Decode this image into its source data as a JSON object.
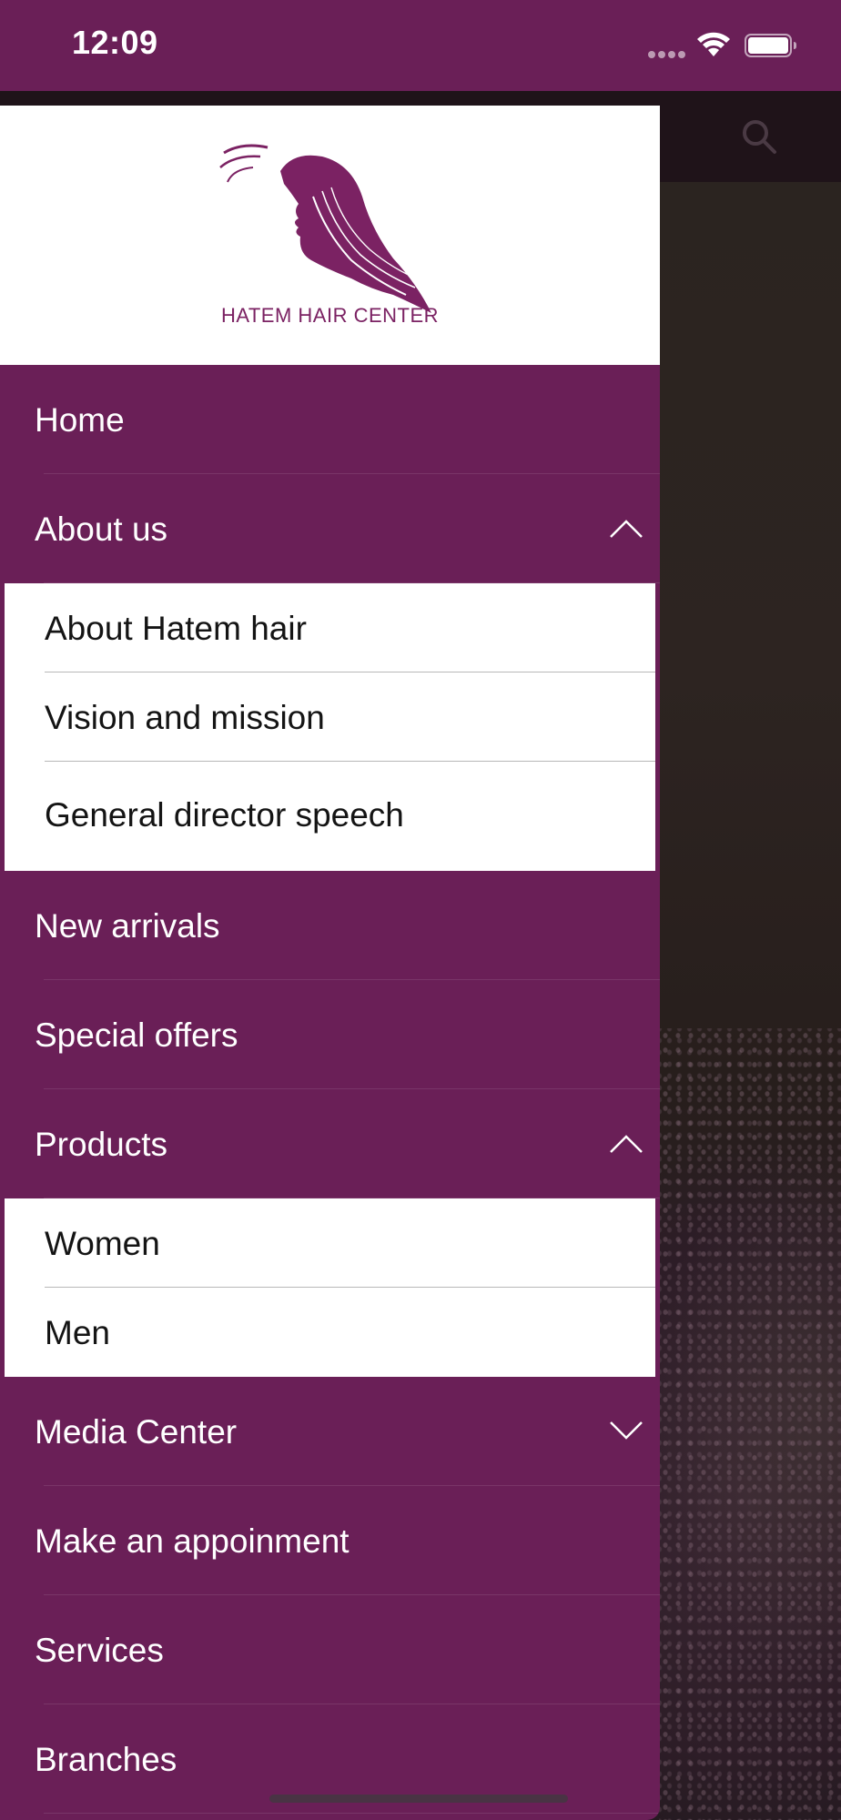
{
  "status_bar": {
    "time": "12:09"
  },
  "drawer": {
    "brand": "HATEM HAIR CENTER",
    "menu": [
      {
        "label": "Home"
      },
      {
        "label": "About us",
        "expanded": true,
        "children": [
          "About Hatem hair",
          "Vision and mission",
          "General director speech"
        ]
      },
      {
        "label": "New arrivals"
      },
      {
        "label": "Special offers"
      },
      {
        "label": "Products",
        "expanded": true,
        "children": [
          "Women",
          "Men"
        ]
      },
      {
        "label": "Media Center",
        "expanded": false
      },
      {
        "label": "Make an appoinment"
      },
      {
        "label": "Services"
      },
      {
        "label": "Branches"
      }
    ]
  },
  "icons": {
    "search": "search-icon",
    "wifi": "wifi-icon",
    "battery": "battery-icon",
    "chevron_up": "chevron-up-icon",
    "chevron_down": "chevron-down-icon"
  },
  "colors": {
    "brand_purple": "#6a1f57",
    "logo_purple": "#7b2263",
    "submenu_bg": "#ffffff"
  }
}
